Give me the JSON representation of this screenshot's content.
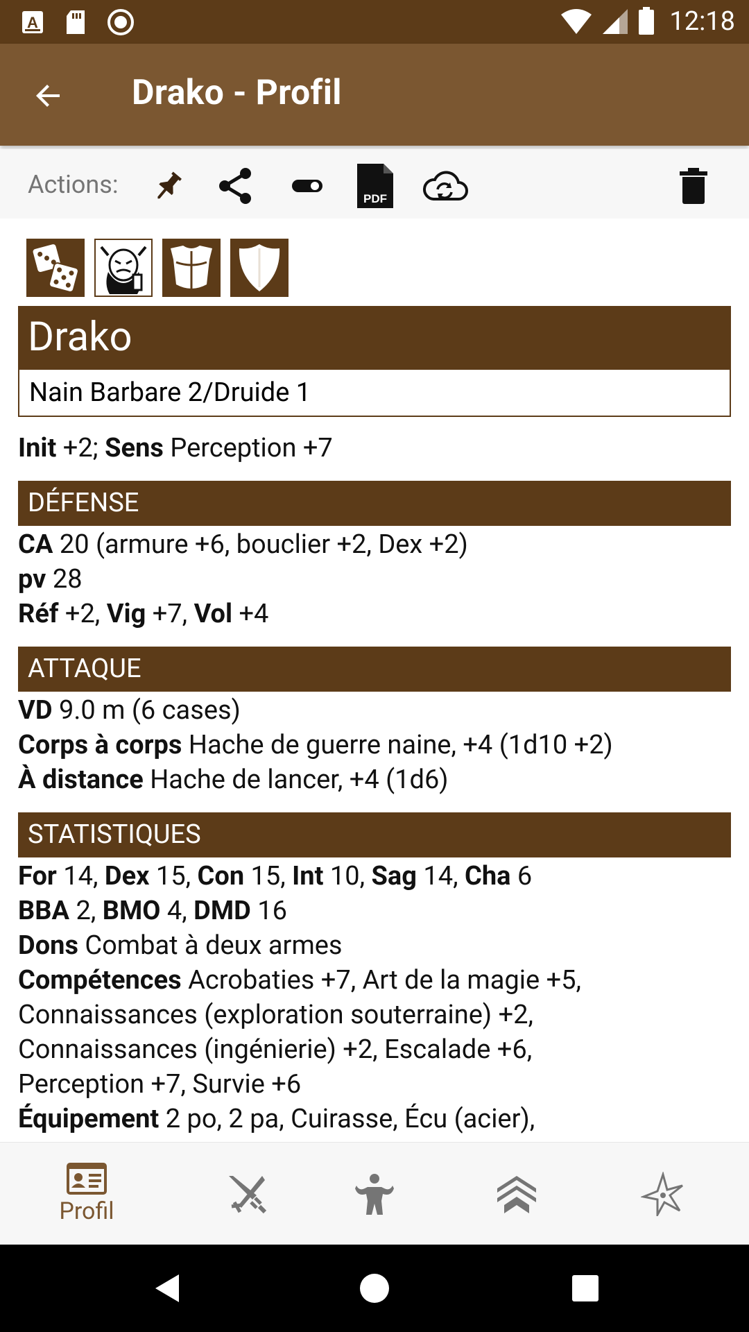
{
  "status_bar": {
    "time": "12:18",
    "icons": [
      "a-notification-icon",
      "sd-card-icon",
      "record-icon",
      "wifi-icon",
      "signal-icon",
      "battery-icon"
    ]
  },
  "app_bar": {
    "title": "Drako - Profil"
  },
  "actions": {
    "label": "Actions:",
    "icons": [
      "pin-icon",
      "share-icon",
      "toggle-icon",
      "pdf-icon",
      "cloud-sync-icon",
      "delete-icon"
    ],
    "pdf_text": "PDF"
  },
  "character": {
    "name": "Drako",
    "subtitle": "Nain Barbare 2/Druide 1"
  },
  "intro": {
    "init_label": "Init",
    "init_value": " +2; ",
    "sens_label": "Sens",
    "sens_value": " Perception +7"
  },
  "sections": {
    "defense": {
      "title": "DÉFENSE",
      "ca_label": "CA",
      "ca_value": " 20 (armure +6, bouclier +2, Dex +2)",
      "pv_label": "pv",
      "pv_value": " 28",
      "ref_label": "Réf",
      "ref_value": " +2, ",
      "vig_label": "Vig",
      "vig_value": " +7, ",
      "vol_label": "Vol",
      "vol_value": " +4"
    },
    "attack": {
      "title": "ATTAQUE",
      "vd_label": "VD",
      "vd_value": " 9.0 m (6 cases)",
      "melee_label": "Corps à corps",
      "melee_value": " Hache de guerre naine, +4 (1d10 +2)",
      "ranged_label": "À distance",
      "ranged_value": " Hache de lancer, +4 (1d6)"
    },
    "stats": {
      "title": "STATISTIQUES",
      "for_label": "For",
      "for_value": " 14, ",
      "dex_label": "Dex",
      "dex_value": " 15, ",
      "con_label": "Con",
      "con_value": " 15, ",
      "int_label": "Int",
      "int_value": " 10, ",
      "sag_label": "Sag",
      "sag_value": " 14, ",
      "cha_label": "Cha",
      "cha_value": " 6",
      "bba_label": "BBA",
      "bba_value": " 2, ",
      "bmo_label": "BMO",
      "bmo_value": " 4, ",
      "dmd_label": "DMD",
      "dmd_value": " 16",
      "dons_label": "Dons",
      "dons_value": " Combat à deux armes",
      "comp_label": "Compétences",
      "comp_line1": " Acrobaties +7, Art de la magie +5,",
      "comp_line2": "Connaissances (exploration souterraine) +2,",
      "comp_line3": "Connaissances (ingénierie) +2, Escalade +6,",
      "comp_line4": "Perception +7, Survie +6",
      "equip_label": "Équipement",
      "equip_value": " 2 po, 2 pa, Cuirasse, Écu (acier),"
    }
  },
  "bottom_nav": {
    "items": [
      {
        "label": "Profil",
        "icon": "id-card-icon",
        "active": true
      },
      {
        "label": "",
        "icon": "combat-icon",
        "active": false
      },
      {
        "label": "",
        "icon": "abilities-icon",
        "active": false
      },
      {
        "label": "",
        "icon": "level-up-icon",
        "active": false
      },
      {
        "label": "",
        "icon": "magic-star-icon",
        "active": false
      }
    ]
  },
  "colors": {
    "status_bar": "#5c3b18",
    "app_bar": "#7b5731",
    "section": "#5c3b18",
    "accent": "#7b5731",
    "inactive_icon": "#757575"
  }
}
